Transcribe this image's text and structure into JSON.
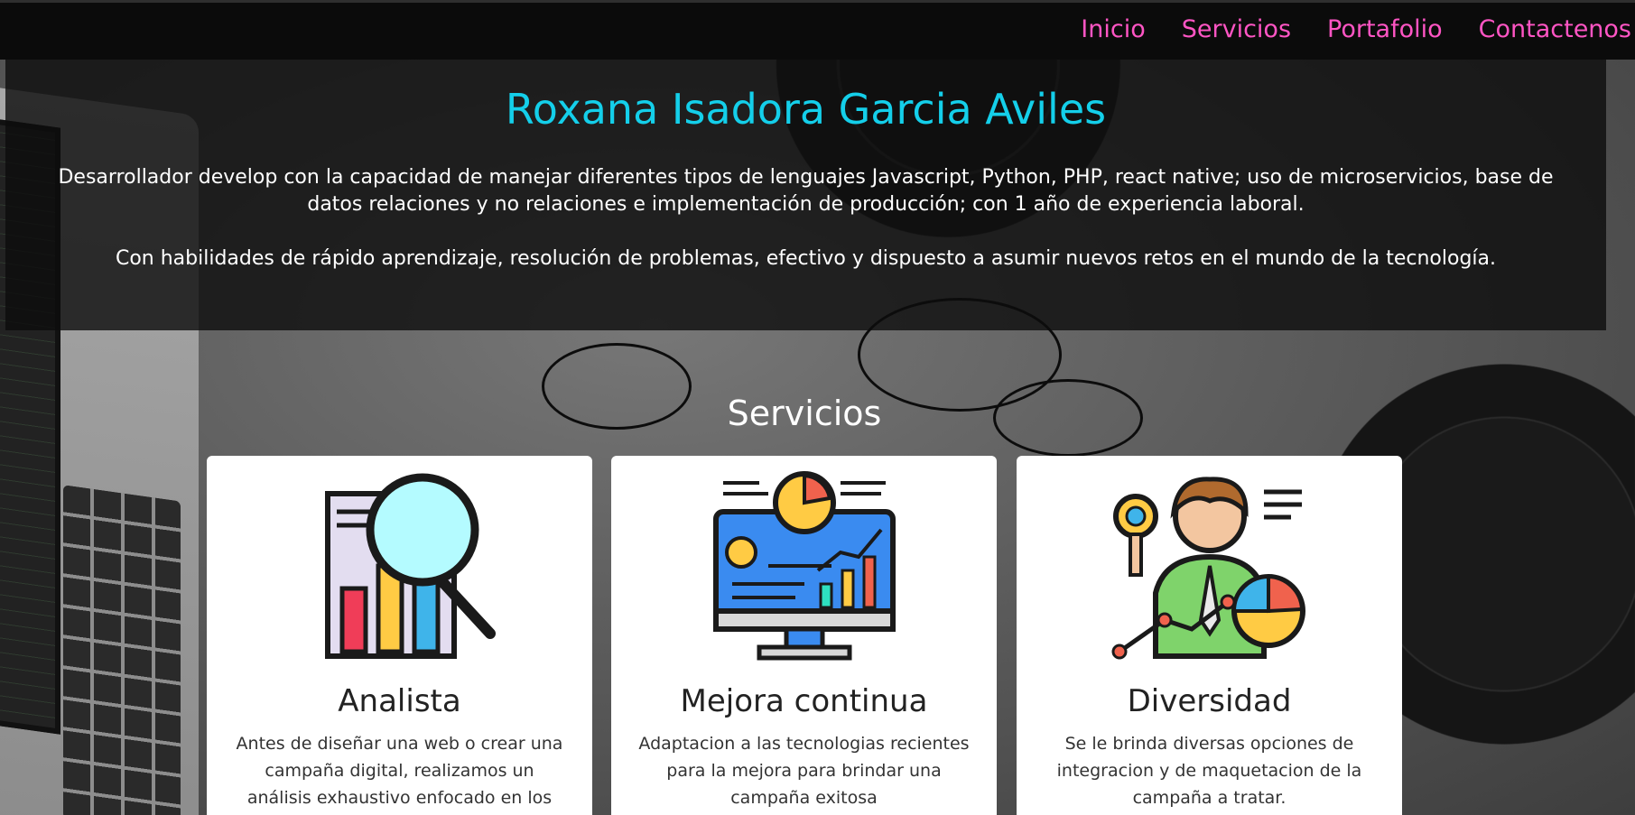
{
  "nav": {
    "items": [
      {
        "label": "Inicio"
      },
      {
        "label": "Servicios"
      },
      {
        "label": "Portafolio"
      },
      {
        "label": "Contactenos"
      }
    ]
  },
  "hero": {
    "title": "Roxana Isadora Garcia Aviles",
    "paragraph_1": "Desarrollador develop con la capacidad de manejar diferentes tipos de lenguajes Javascript, Python, PHP, react native; uso de microservicios, base de datos relaciones y no relaciones e implementación de producción; con 1 año de experiencia laboral.",
    "paragraph_2": "Con habilidades de rápido aprendizaje, resolución de problemas, efectivo y dispuesto a asumir nuevos retos en el mundo de la tecnología."
  },
  "services": {
    "title": "Servicios",
    "cards": [
      {
        "title": "Analista",
        "text": "Antes de diseñar una web o crear una campaña digital, realizamos un análisis exhaustivo enfocado en los objetivos del",
        "icon": "magnifier-chart-icon"
      },
      {
        "title": "Mejora continua",
        "text": "Adaptacion a las tecnologias recientes para la mejora para brindar una campaña exitosa",
        "icon": "monitor-analytics-icon"
      },
      {
        "title": "Diversidad",
        "text": "Se le brinda diversas opciones de integracion y de maquetacion de la campaña a tratar.",
        "icon": "analyst-person-icon"
      }
    ]
  },
  "colors": {
    "nav_link": "#ff55c4",
    "hero_title": "#14cfea",
    "navbar_bg": "#0b0b0b"
  }
}
